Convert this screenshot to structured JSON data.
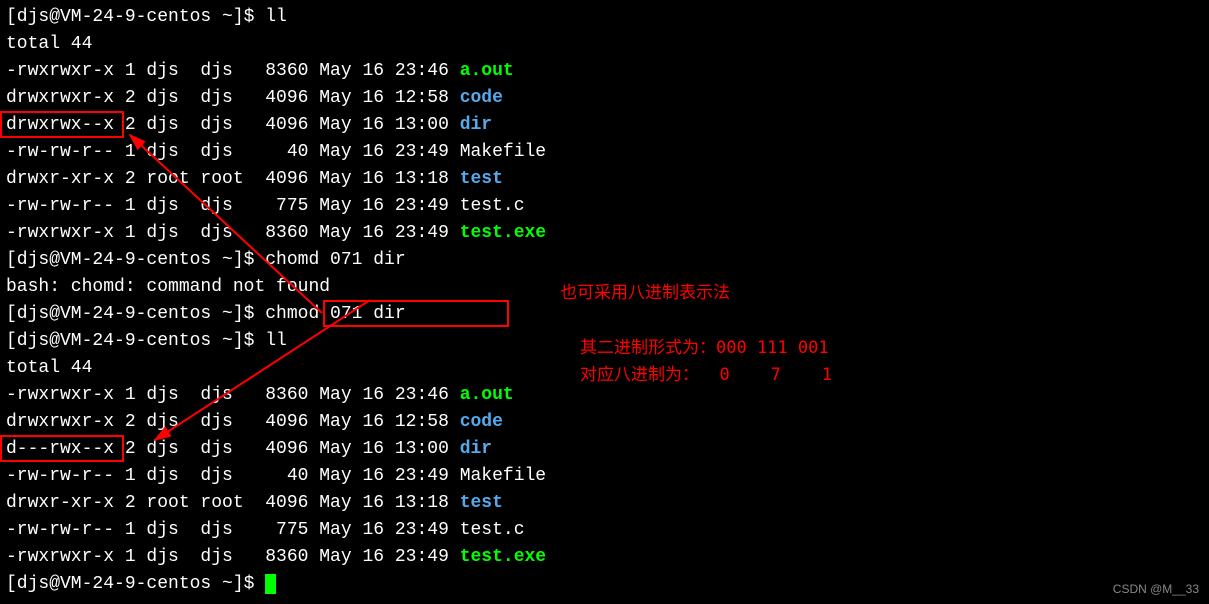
{
  "prompt1": "[djs@VM-24-9-centos ~]$ ll",
  "total1": "total 44",
  "ls1": [
    {
      "perm": "-rwxrwxr-x",
      "links": "1",
      "owner": "djs ",
      "group": "djs ",
      "size": " 8360",
      "date": "May 16 23:46",
      "name": "a.out",
      "cls": "green"
    },
    {
      "perm": "drwxrwxr-x",
      "links": "2",
      "owner": "djs ",
      "group": "djs ",
      "size": " 4096",
      "date": "May 16 12:58",
      "name": "code",
      "cls": "cyan"
    },
    {
      "perm": "drwxrwx--x",
      "links": "2",
      "owner": "djs ",
      "group": "djs ",
      "size": " 4096",
      "date": "May 16 13:00",
      "name": "dir",
      "cls": "cyan"
    },
    {
      "perm": "-rw-rw-r--",
      "links": "1",
      "owner": "djs ",
      "group": "djs ",
      "size": "   40",
      "date": "May 16 23:49",
      "name": "Makefile",
      "cls": "white"
    },
    {
      "perm": "drwxr-xr-x",
      "links": "2",
      "owner": "root",
      "group": "root",
      "size": " 4096",
      "date": "May 16 13:18",
      "name": "test",
      "cls": "cyan"
    },
    {
      "perm": "-rw-rw-r--",
      "links": "1",
      "owner": "djs ",
      "group": "djs ",
      "size": "  775",
      "date": "May 16 23:49",
      "name": "test.c",
      "cls": "white"
    },
    {
      "perm": "-rwxrwxr-x",
      "links": "1",
      "owner": "djs ",
      "group": "djs ",
      "size": " 8360",
      "date": "May 16 23:49",
      "name": "test.exe",
      "cls": "green"
    }
  ],
  "prompt2": "[djs@VM-24-9-centos ~]$ chomd 071 dir",
  "err": "bash: chomd: command not found",
  "prompt3": "[djs@VM-24-9-centos ~]$ chmod 071 dir",
  "prompt4": "[djs@VM-24-9-centos ~]$ ll",
  "total2": "total 44",
  "ls2": [
    {
      "perm": "-rwxrwxr-x",
      "links": "1",
      "owner": "djs ",
      "group": "djs ",
      "size": " 8360",
      "date": "May 16 23:46",
      "name": "a.out",
      "cls": "green"
    },
    {
      "perm": "drwxrwxr-x",
      "links": "2",
      "owner": "djs ",
      "group": "djs ",
      "size": " 4096",
      "date": "May 16 12:58",
      "name": "code",
      "cls": "cyan"
    },
    {
      "perm": "d---rwx--x",
      "links": "2",
      "owner": "djs ",
      "group": "djs ",
      "size": " 4096",
      "date": "May 16 13:00",
      "name": "dir",
      "cls": "cyan"
    },
    {
      "perm": "-rw-rw-r--",
      "links": "1",
      "owner": "djs ",
      "group": "djs ",
      "size": "   40",
      "date": "May 16 23:49",
      "name": "Makefile",
      "cls": "white"
    },
    {
      "perm": "drwxr-xr-x",
      "links": "2",
      "owner": "root",
      "group": "root",
      "size": " 4096",
      "date": "May 16 13:18",
      "name": "test",
      "cls": "cyan"
    },
    {
      "perm": "-rw-rw-r--",
      "links": "1",
      "owner": "djs ",
      "group": "djs ",
      "size": "  775",
      "date": "May 16 23:49",
      "name": "test.c",
      "cls": "white"
    },
    {
      "perm": "-rwxrwxr-x",
      "links": "1",
      "owner": "djs ",
      "group": "djs ",
      "size": " 8360",
      "date": "May 16 23:49",
      "name": "test.exe",
      "cls": "green"
    }
  ],
  "prompt5": "[djs@VM-24-9-centos ~]$ ",
  "annotations": {
    "line1": "也可采用八进制表示法",
    "line2a": "其二进制形式为：",
    "line2b": "000 111 001",
    "line3a": "对应八进制为：",
    "line3b": "  0    7    1"
  },
  "watermark": "CSDN @M__33"
}
